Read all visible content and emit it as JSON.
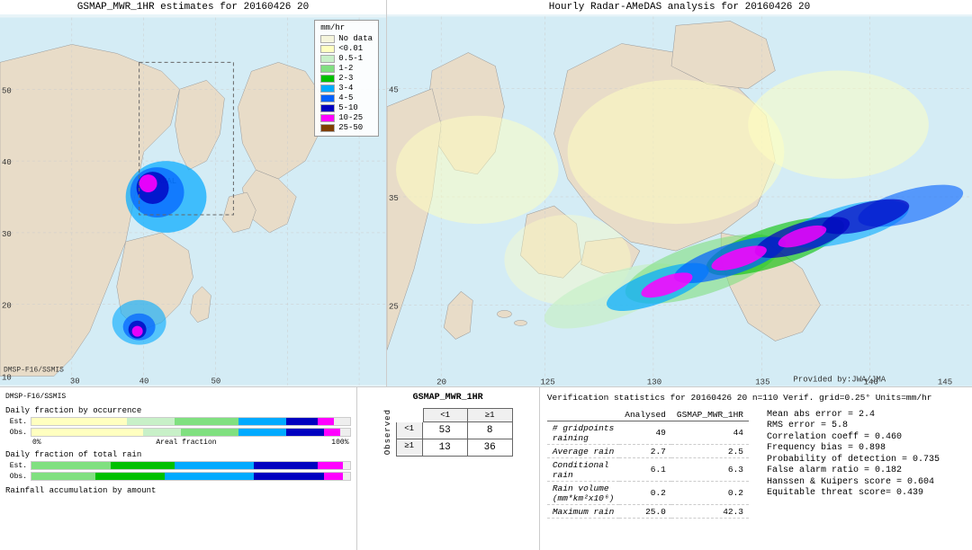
{
  "left_map": {
    "title": "GSMAP_MWR_1HR estimates for 20160426 20",
    "satellite": "DMSP-F16/SSMIS"
  },
  "right_map": {
    "title": "Hourly Radar-AMeDAS analysis for 20160426 20",
    "watermark": "Provided by:JWA/JMA"
  },
  "legend": {
    "title": "mm/hr",
    "items": [
      {
        "label": "No data",
        "color": "#f5f5dc"
      },
      {
        "label": "<0.01",
        "color": "#ffffc0"
      },
      {
        "label": "0.5-1",
        "color": "#c8f0c8"
      },
      {
        "label": "1-2",
        "color": "#80e080"
      },
      {
        "label": "2-3",
        "color": "#00c000"
      },
      {
        "label": "3-4",
        "color": "#00aaff"
      },
      {
        "label": "4-5",
        "color": "#0060ff"
      },
      {
        "label": "5-10",
        "color": "#0000c0"
      },
      {
        "label": "10-25",
        "color": "#ff00ff"
      },
      {
        "label": "25-50",
        "color": "#804000"
      }
    ]
  },
  "bottom_left": {
    "satellite_label": "DMSP-F16/SSMIS",
    "chart1_title": "Daily fraction by occurrence",
    "chart2_title": "Daily fraction of total rain",
    "chart3_title": "Rainfall accumulation by amount",
    "est_label": "Est.",
    "obs_label": "Obs.",
    "x_axis": [
      "0%",
      "Areal fraction",
      "100%"
    ]
  },
  "contingency_table": {
    "title": "GSMAP_MWR_1HR",
    "col_header_lt1": "<1",
    "col_header_gte1": "≥1",
    "row_header_lt1": "<1",
    "row_header_gte1": "≥1",
    "observed_label": "O\nb\ns\ne\nr\nv\ne\nd",
    "values": {
      "lt1_lt1": "53",
      "lt1_gte1": "8",
      "gte1_lt1": "13",
      "gte1_gte1": "36"
    }
  },
  "verification": {
    "title": "Verification statistics for 20160426 20  n=110  Verif. grid=0.25°  Units=mm/hr",
    "table": {
      "headers": [
        "",
        "Analysed",
        "GSMAP_MWR_1HR"
      ],
      "rows": [
        {
          "label": "# gridpoints raining",
          "analysed": "49",
          "gsmap": "44"
        },
        {
          "label": "Average rain",
          "analysed": "2.7",
          "gsmap": "2.5"
        },
        {
          "label": "Conditional rain",
          "analysed": "6.1",
          "gsmap": "6.3"
        },
        {
          "label": "Rain volume (mm*km²x10⁶)",
          "analysed": "0.2",
          "gsmap": "0.2"
        },
        {
          "label": "Maximum rain",
          "analysed": "25.0",
          "gsmap": "42.3"
        }
      ]
    },
    "stats": [
      {
        "label": "Mean abs error",
        "value": "2.4"
      },
      {
        "label": "RMS error",
        "value": "5.8"
      },
      {
        "label": "Correlation coeff",
        "value": "0.460"
      },
      {
        "label": "Frequency bias",
        "value": "0.898"
      },
      {
        "label": "Probability of detection",
        "value": "0.735"
      },
      {
        "label": "False alarm ratio",
        "value": "0.182"
      },
      {
        "label": "Hanssen & Kuipers score",
        "value": "0.604"
      },
      {
        "label": "Equitable threat score",
        "value": "0.439"
      }
    ]
  }
}
